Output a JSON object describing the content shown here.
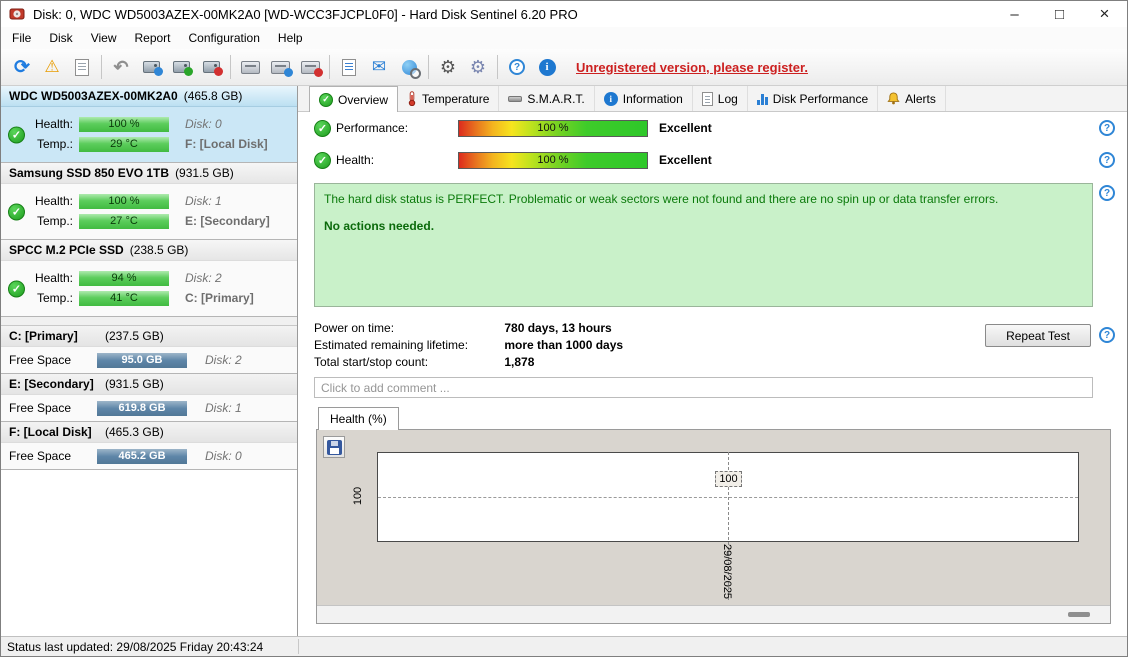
{
  "icons": {
    "check": "✓",
    "refresh": "⟳",
    "warning": "⚠",
    "undo": "↶",
    "mail": "✉",
    "gear": "⚙",
    "help": "?",
    "info": "i",
    "minimize": "–",
    "maximize": "□",
    "close": "×",
    "report": "≡"
  },
  "window": {
    "title": "Disk: 0, WDC WD5003AZEX-00MK2A0 [WD-WCC3FJCPL0F0]  -  Hard Disk Sentinel 6.20 PRO"
  },
  "menu": {
    "items": [
      {
        "label": "File"
      },
      {
        "label": "Disk"
      },
      {
        "label": "View"
      },
      {
        "label": "Report"
      },
      {
        "label": "Configuration"
      },
      {
        "label": "Help"
      }
    ]
  },
  "toolbar": {
    "register_link": "Unregistered version, please register."
  },
  "sidebar": {
    "disks": [
      {
        "name": "WDC WD5003AZEX-00MK2A0",
        "size": "(465.8 GB)",
        "health_label": "Health:",
        "health_value": "100 %",
        "disk_label": "Disk: 0",
        "temp_label": "Temp.:",
        "temp_value": "29 °C",
        "drive_label": "F: [Local Disk]"
      },
      {
        "name": "Samsung SSD 850 EVO 1TB",
        "size": "(931.5 GB)",
        "health_label": "Health:",
        "health_value": "100 %",
        "disk_label": "Disk: 1",
        "temp_label": "Temp.:",
        "temp_value": "27 °C",
        "drive_label": "E: [Secondary]"
      },
      {
        "name": "SPCC M.2 PCIe SSD",
        "size": "(238.5 GB)",
        "health_label": "Health:",
        "health_value": "94 %",
        "disk_label": "Disk: 2",
        "temp_label": "Temp.:",
        "temp_value": "41 °C",
        "drive_label": "C: [Primary]"
      }
    ],
    "partitions": [
      {
        "name": "C: [Primary]",
        "size": "(237.5 GB)",
        "free_label": "Free Space",
        "free_value": "95.0 GB",
        "disk_label": "Disk: 2"
      },
      {
        "name": "E: [Secondary]",
        "size": "(931.5 GB)",
        "free_label": "Free Space",
        "free_value": "619.8 GB",
        "disk_label": "Disk: 1"
      },
      {
        "name": "F: [Local Disk]",
        "size": "(465.3 GB)",
        "free_label": "Free Space",
        "free_value": "465.2 GB",
        "disk_label": "Disk: 0"
      }
    ]
  },
  "tabs": {
    "items": [
      {
        "label": "Overview"
      },
      {
        "label": "Temperature"
      },
      {
        "label": "S.M.A.R.T."
      },
      {
        "label": "Information"
      },
      {
        "label": "Log"
      },
      {
        "label": "Disk Performance"
      },
      {
        "label": "Alerts"
      }
    ]
  },
  "overview": {
    "performance_label": "Performance:",
    "performance_value": "100 %",
    "performance_rating": "Excellent",
    "health_label": "Health:",
    "health_value": "100 %",
    "health_rating": "Excellent",
    "status_text": "The hard disk status is PERFECT. Problematic or weak sectors were not found and there are no spin up or data transfer errors.",
    "status_action": "No actions needed.",
    "stats": [
      {
        "label": "Power on time:",
        "value": "780 days, 13 hours"
      },
      {
        "label": "Estimated remaining lifetime:",
        "value": "more than 1000 days"
      },
      {
        "label": "Total start/stop count:",
        "value": "1,878"
      }
    ],
    "repeat_test_label": "Repeat Test",
    "comment_placeholder": "Click to add comment ..."
  },
  "chart_data": {
    "type": "line",
    "title": "Health (%)",
    "tab_label": "Health (%)",
    "x": [
      "29/08/2025"
    ],
    "values": [
      100
    ],
    "ylim": [
      0,
      100
    ],
    "y_tick": "100",
    "point_label": "100",
    "x_tick": "29/08/2025",
    "grid": "dashed-crosshair"
  },
  "statusbar": {
    "text": "Status last updated: 29/08/2025 Friday 20:43:24"
  }
}
